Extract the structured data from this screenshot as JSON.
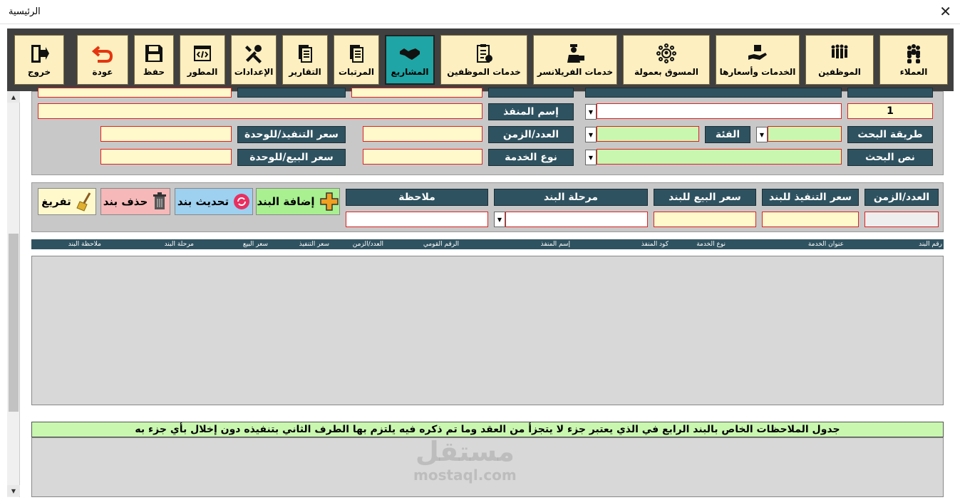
{
  "window": {
    "title": "الرئيسية",
    "close": "✕"
  },
  "toolbar": {
    "items": [
      {
        "label": "العملاء",
        "icon": "customers-icon"
      },
      {
        "label": "الموظفين",
        "icon": "employees-icon"
      },
      {
        "label": "الخدمات وأسعارها",
        "icon": "services-prices-icon"
      },
      {
        "label": "المسوق بعمولة",
        "icon": "affiliate-icon"
      },
      {
        "label": "خدمات الفريلانسر",
        "icon": "freelancer-icon"
      },
      {
        "label": "خدمات الموظفين",
        "icon": "clipboard-icon"
      },
      {
        "label": "المشاريع",
        "icon": "handshake-icon",
        "active": true
      },
      {
        "label": "المرتبات",
        "icon": "document-icon"
      },
      {
        "label": "التقارير",
        "icon": "reports-icon"
      },
      {
        "label": "الإعدادات",
        "icon": "tools-icon"
      },
      {
        "label": "المطور",
        "icon": "code-icon"
      },
      {
        "label": "حفظ",
        "icon": "save-icon"
      },
      {
        "label": "عودة",
        "icon": "undo-icon"
      },
      {
        "label": "خروج",
        "icon": "exit-icon"
      }
    ]
  },
  "form": {
    "item_number_value": "1",
    "labels": {
      "executor_name": "إسم المنفذ",
      "search_method": "طريقة البحث",
      "category": "الفئة",
      "count_time": "العدد/الزمن",
      "exec_price_unit": "سعر التنفيذ/للوحدة",
      "search_text": "نص البحث",
      "service_type": "نوع الخدمة",
      "sale_price_unit": "سعر البيع/للوحدة"
    }
  },
  "item": {
    "labels": {
      "count_time": "العدد/الزمن",
      "exec_price": "سعر التنفيذ للبند",
      "sale_price": "سعر البيع للبند",
      "stage": "مرحلة البند",
      "note": "ملاحظة"
    },
    "buttons": {
      "add": "إضافة البند",
      "update": "تحديث بند",
      "delete": "حذف بند",
      "clear": "تفريغ"
    }
  },
  "table": {
    "headers": [
      "رقم البند",
      "عنوان الخدمة",
      "نوع الخدمة",
      "كود المنفذ",
      "إسم المنفذ",
      "الرقم القومي",
      "العدد/الزمن",
      "سعر التنفيذ",
      "سعر البيع",
      "مرحلة البند",
      "ملاحظة البند"
    ]
  },
  "notes": {
    "header": "جدول الملاحظات الخاص بالبند الرابع في الذي يعتبر جزء لا يتجزأ من العقد وما تم ذكره فيه يلتزم بها الطرف الثاني بتنفيذه دون إخلال بأي جزء به"
  },
  "watermark": {
    "ar": "مستقل",
    "en": "mostaql.com"
  },
  "colors": {
    "label_bg": "#2f5260",
    "active_tab": "#1fa5a5",
    "tab_bg": "#fdefc0",
    "input_yellow": "#fff9cc",
    "input_green": "#c9f7b0"
  }
}
